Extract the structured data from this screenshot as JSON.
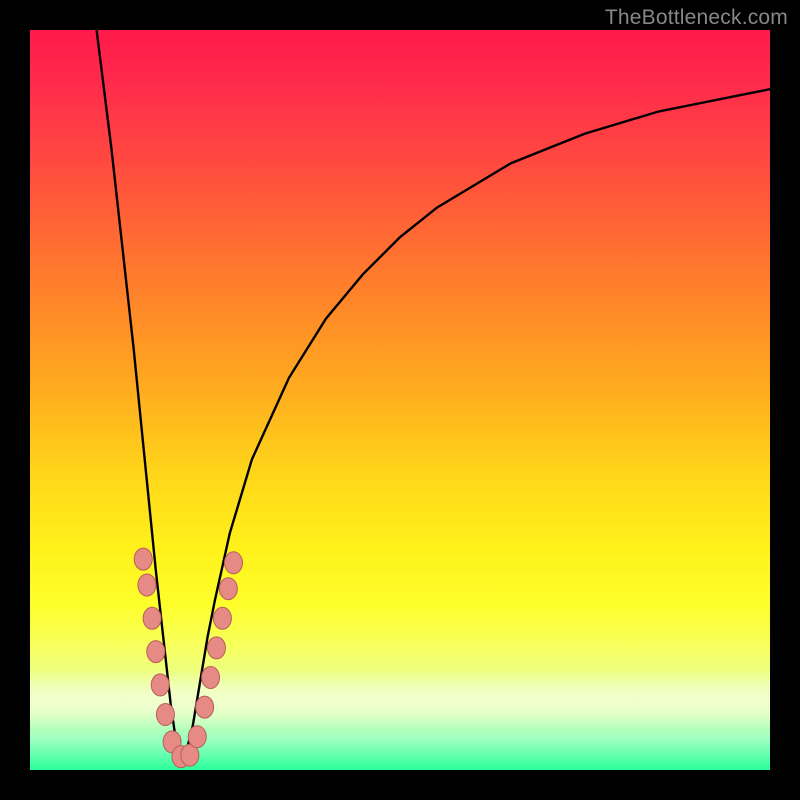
{
  "watermark": "TheBottleneck.com",
  "colors": {
    "frame": "#000000",
    "curve": "#000000",
    "dot_fill": "#e58a84",
    "dot_stroke": "#b85f5a",
    "gradient_top": "#ff1a4b",
    "gradient_bottom": "#2bff9a"
  },
  "chart_data": {
    "type": "line",
    "title": "",
    "xlabel": "",
    "ylabel": "",
    "xlim": [
      0,
      100
    ],
    "ylim": [
      0,
      100
    ],
    "grid": false,
    "legend": false,
    "description": "V-shaped bottleneck curve with sharp minimum near x≈20 overlaid on red-to-green vertical gradient; scattered sample dots cluster along the valley walls.",
    "series": [
      {
        "name": "bottleneck_curve",
        "x": [
          9,
          10,
          11,
          12,
          13,
          14,
          15,
          16,
          17,
          18,
          19,
          20,
          21,
          22,
          23,
          24,
          25,
          27,
          30,
          35,
          40,
          45,
          50,
          55,
          60,
          65,
          70,
          75,
          80,
          85,
          90,
          95,
          100
        ],
        "y": [
          100,
          92,
          84,
          75,
          66,
          57,
          47,
          37,
          27,
          18,
          9,
          2,
          2,
          6,
          12,
          18,
          23,
          32,
          42,
          53,
          61,
          67,
          72,
          76,
          79,
          82,
          84,
          86,
          87.5,
          89,
          90,
          91,
          92
        ]
      }
    ],
    "dots": [
      {
        "x": 15.3,
        "y": 28.5
      },
      {
        "x": 15.8,
        "y": 25.0
      },
      {
        "x": 16.5,
        "y": 20.5
      },
      {
        "x": 17.0,
        "y": 16.0
      },
      {
        "x": 17.6,
        "y": 11.5
      },
      {
        "x": 18.3,
        "y": 7.5
      },
      {
        "x": 19.2,
        "y": 3.8
      },
      {
        "x": 20.4,
        "y": 1.8
      },
      {
        "x": 21.6,
        "y": 2.0
      },
      {
        "x": 22.6,
        "y": 4.5
      },
      {
        "x": 23.6,
        "y": 8.5
      },
      {
        "x": 24.4,
        "y": 12.5
      },
      {
        "x": 25.2,
        "y": 16.5
      },
      {
        "x": 26.0,
        "y": 20.5
      },
      {
        "x": 26.8,
        "y": 24.5
      },
      {
        "x": 27.5,
        "y": 28.0
      }
    ]
  }
}
